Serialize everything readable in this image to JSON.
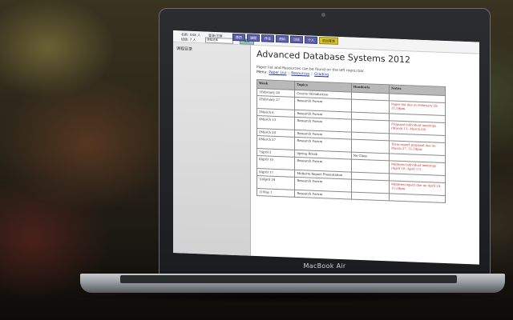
{
  "device": {
    "brand_label": "MacBook Air"
  },
  "topbar": {
    "row1_label": "名前: XXX 人",
    "row1_label2": "登录/注销",
    "row2_label": "班级: 7 人",
    "select_value": "课程选择",
    "go_label": "确定",
    "tabs": [
      {
        "label": "首页"
      },
      {
        "label": "课程"
      },
      {
        "label": "作业"
      },
      {
        "label": "资料"
      },
      {
        "label": "讨论"
      },
      {
        "label": "个人"
      },
      {
        "label": "退出登录"
      }
    ]
  },
  "sidebar": {
    "title": "课程目录"
  },
  "page": {
    "title": "Advanced Database Systems 2012",
    "intro": "Paper list and Resources can be found on the left menu bar.",
    "menu_prefix": "Menu: ",
    "menu_links": [
      "Paper List",
      "Resources",
      "Grading"
    ],
    "menu_sep": " :: "
  },
  "table": {
    "headers": [
      "Week",
      "Topics",
      "Handouts",
      "Notes"
    ],
    "rows": [
      {
        "week": "1February 20",
        "topic": "Course Introduction",
        "handout": "",
        "note": ""
      },
      {
        "week": "2February 27",
        "topic": "Research Forum",
        "handout": "",
        "note": "Paper list due on February 29, 11:59pm."
      },
      {
        "week": "3March 6",
        "topic": "Research Forum",
        "handout": "",
        "note": ""
      },
      {
        "week": "4March 13",
        "topic": "Research Forum",
        "handout": "",
        "note": "Proposal individual meetings (March 13~March 20)"
      },
      {
        "week": "5March 20",
        "topic": "Research Forum",
        "handout": "",
        "note": ""
      },
      {
        "week": "6March 27",
        "topic": "Research Forum",
        "handout": "",
        "note": "Term report proposal due on March 27, 11:59pm."
      },
      {
        "week": "7April 3",
        "topic": "Spring Break",
        "handout": "No Class",
        "note": ""
      },
      {
        "week": "8April 10",
        "topic": "Research Forum",
        "handout": "",
        "note": "Midterm individual meetings (April 10~April 17)"
      },
      {
        "week": "9April 17",
        "topic": "Midterm Report Presentation",
        "handout": "",
        "note": ""
      },
      {
        "week": "10April 24",
        "topic": "Research Forum",
        "handout": "",
        "note": "Midterm report due on April 24, 11:59pm."
      },
      {
        "week": "11May 1",
        "topic": "Research Forum",
        "handout": "",
        "note": ""
      }
    ]
  }
}
